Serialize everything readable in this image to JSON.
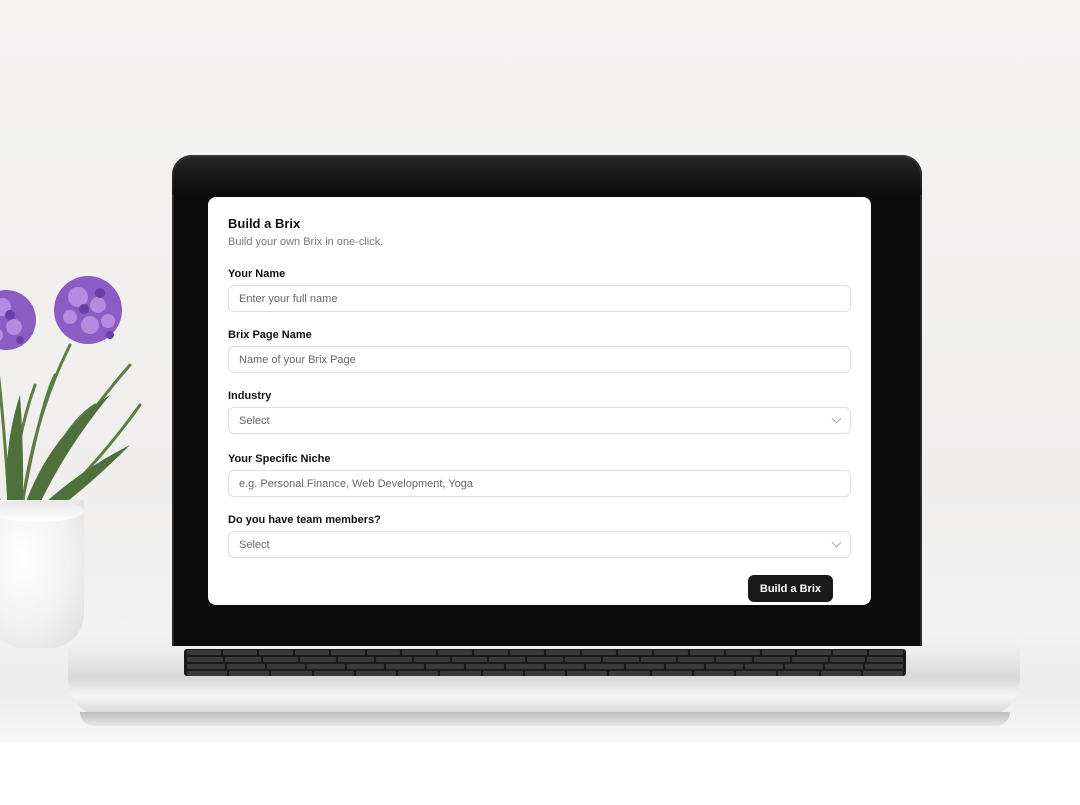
{
  "form": {
    "title": "Build a Brix",
    "subtitle": "Build your own Brix in one-click.",
    "fields": [
      {
        "label": "Your Name",
        "placeholder": "Enter your full name",
        "type": "text"
      },
      {
        "label": "Brix Page Name",
        "placeholder": "Name of your Brix Page",
        "type": "text"
      },
      {
        "label": "Industry",
        "placeholder": "Select",
        "type": "select"
      },
      {
        "label": "Your Specific Niche",
        "placeholder": "e.g. Personal Finance, Web Development, Yoga",
        "type": "text"
      },
      {
        "label": "Do you have team members?",
        "placeholder": "Select",
        "type": "select"
      }
    ],
    "submit_label": "Build a Brix"
  },
  "colors": {
    "button_bg": "#1a1a1a",
    "field_border": "#dedede",
    "flower": "#8a5cc4"
  },
  "icons": [
    "chevron-down-icon",
    "flower-plant",
    "laptop"
  ]
}
